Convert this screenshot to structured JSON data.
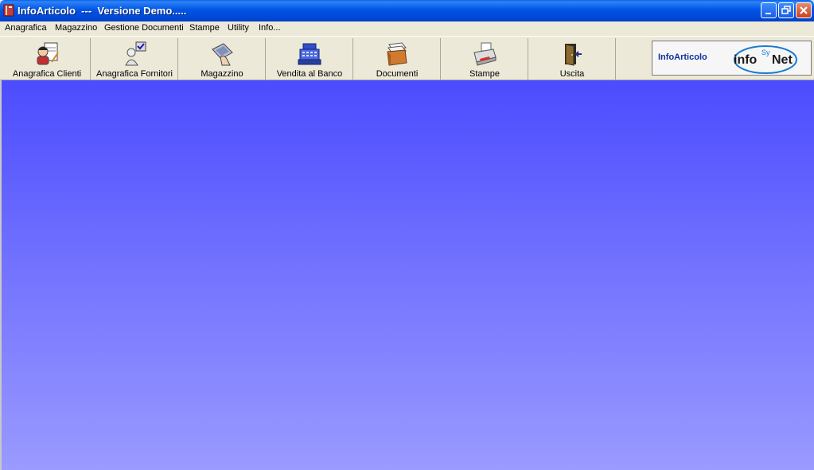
{
  "window": {
    "title": "InfoArticolo  ---  Versione Demo....."
  },
  "menu": [
    {
      "label": "Anagrafica"
    },
    {
      "label": "Magazzino"
    },
    {
      "label": "Gestione Documenti"
    },
    {
      "label": "Stampe"
    },
    {
      "label": "Utility"
    },
    {
      "label": "Info..."
    }
  ],
  "toolbar": [
    {
      "label": "Anagrafica Clienti",
      "icon": "client-notepad-icon"
    },
    {
      "label": "Anagrafica Fornitori",
      "icon": "supplier-check-icon"
    },
    {
      "label": "Magazzino",
      "icon": "warehouse-hand-icon"
    },
    {
      "label": "Vendita al Banco",
      "icon": "cash-register-icon"
    },
    {
      "label": "Documenti",
      "icon": "document-box-icon"
    },
    {
      "label": "Stampe",
      "icon": "printer-icon"
    },
    {
      "label": "Uscita",
      "icon": "exit-door-icon"
    }
  ],
  "brand": {
    "product_name": "InfoArticolo",
    "logo_text_info": "info",
    "logo_text_sy": "Sy",
    "logo_text_net": "Net"
  },
  "colors": {
    "titlebar": "#0055e5",
    "desktop_top": "#4c4cff",
    "desktop_bottom": "#9a9aff",
    "brand_blue": "#102e9a"
  }
}
